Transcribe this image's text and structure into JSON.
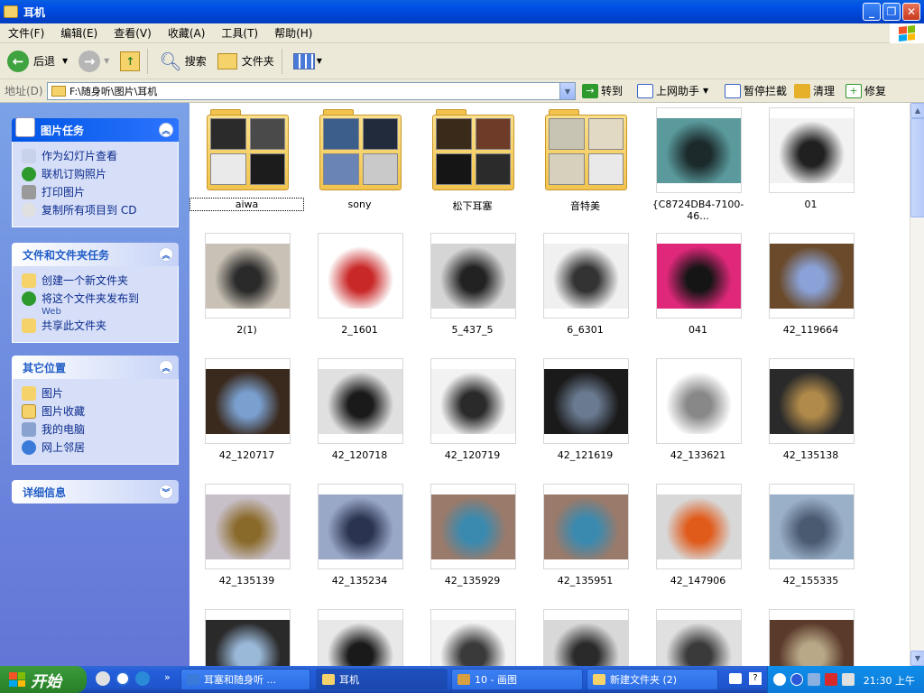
{
  "window": {
    "title": "耳机"
  },
  "menu": [
    "文件(F)",
    "编辑(E)",
    "查看(V)",
    "收藏(A)",
    "工具(T)",
    "帮助(H)"
  ],
  "toolbar": {
    "back": "后退",
    "search": "搜索",
    "folders": "文件夹"
  },
  "address": {
    "label": "地址(D)",
    "path": "F:\\随身听\\图片\\耳机",
    "go": "转到"
  },
  "addons": [
    "上网助手",
    "暂停拦截",
    "清理",
    "修复"
  ],
  "sidebar": {
    "picture_tasks": {
      "title": "图片任务",
      "items": [
        "作为幻灯片查看",
        "联机订购照片",
        "打印图片",
        "复制所有项目到 CD"
      ]
    },
    "file_tasks": {
      "title": "文件和文件夹任务",
      "items": [
        "创建一个新文件夹",
        "将这个文件夹发布到",
        "共享此文件夹"
      ],
      "publish_sub": "Web"
    },
    "other_places": {
      "title": "其它位置",
      "items": [
        "图片",
        "图片收藏",
        "我的电脑",
        "网上邻居"
      ]
    },
    "details": {
      "title": "详细信息"
    }
  },
  "files": [
    {
      "name": "aiwa",
      "kind": "folder",
      "colors": [
        "#2b2b2b",
        "#4a4a4a",
        "#eaeaea",
        "#1c1c1c"
      ]
    },
    {
      "name": "sony",
      "kind": "folder",
      "colors": [
        "#3c5e8a",
        "#222b3b",
        "#6a84b6",
        "#c9c9c9"
      ]
    },
    {
      "name": "松下耳塞",
      "kind": "folder",
      "colors": [
        "#3a2a1a",
        "#6d3b28",
        "#151515",
        "#2b2b2b"
      ]
    },
    {
      "name": "音特美",
      "kind": "folder",
      "colors": [
        "#c8c4b4",
        "#e2d9c5",
        "#d6d0bc",
        "#e9e9e9"
      ]
    },
    {
      "name": "{C8724DB4-7100-46...",
      "kind": "image",
      "colors": [
        "#5a9a9c",
        "#1c2a2c"
      ]
    },
    {
      "name": "01",
      "kind": "image",
      "colors": [
        "#f2f2f2",
        "#202020"
      ]
    },
    {
      "name": "2(1)",
      "kind": "image",
      "colors": [
        "#c9c1b5",
        "#2a2a2a"
      ]
    },
    {
      "name": "2_1601",
      "kind": "image",
      "colors": [
        "#ffffff",
        "#c92828"
      ]
    },
    {
      "name": "5_437_5",
      "kind": "image",
      "colors": [
        "#d5d5d5",
        "#222"
      ]
    },
    {
      "name": "6_6301",
      "kind": "image",
      "colors": [
        "#f0f0f0",
        "#333"
      ]
    },
    {
      "name": "041",
      "kind": "image",
      "colors": [
        "#e0287a",
        "#151515"
      ]
    },
    {
      "name": "42_119664",
      "kind": "image",
      "colors": [
        "#6a4a2a",
        "#8aa2d8"
      ]
    },
    {
      "name": "42_120717",
      "kind": "image",
      "colors": [
        "#3a2a1e",
        "#7aa0d0"
      ]
    },
    {
      "name": "42_120718",
      "kind": "image",
      "colors": [
        "#e0e0e0",
        "#1a1a1a"
      ]
    },
    {
      "name": "42_120719",
      "kind": "image",
      "colors": [
        "#f2f2f2",
        "#2a2a2a"
      ]
    },
    {
      "name": "42_121619",
      "kind": "image",
      "colors": [
        "#1a1a1a",
        "#6a7a90"
      ]
    },
    {
      "name": "42_133621",
      "kind": "image",
      "colors": [
        "#ffffff",
        "#888"
      ]
    },
    {
      "name": "42_135138",
      "kind": "image",
      "colors": [
        "#2a2a2a",
        "#b08a4a"
      ]
    },
    {
      "name": "42_135139",
      "kind": "image",
      "colors": [
        "#c8c0c8",
        "#8a6a2a"
      ]
    },
    {
      "name": "42_135234",
      "kind": "image",
      "colors": [
        "#9aa8c8",
        "#2a3450"
      ]
    },
    {
      "name": "42_135929",
      "kind": "image",
      "colors": [
        "#9a7a6a",
        "#3a8ab0"
      ]
    },
    {
      "name": "42_135951",
      "kind": "image",
      "colors": [
        "#9a7a6a",
        "#3a8ab0"
      ]
    },
    {
      "name": "42_147906",
      "kind": "image",
      "colors": [
        "#d8d8d8",
        "#e05a1a"
      ]
    },
    {
      "name": "42_155335",
      "kind": "image",
      "colors": [
        "#9ab0c8",
        "#4a5a70"
      ]
    },
    {
      "name": "",
      "kind": "image",
      "colors": [
        "#2a2a2a",
        "#9ab8d8"
      ]
    },
    {
      "name": "",
      "kind": "image",
      "colors": [
        "#e8e8e8",
        "#1a1a1a"
      ]
    },
    {
      "name": "",
      "kind": "image",
      "colors": [
        "#f2f2f2",
        "#3a3a3a"
      ]
    },
    {
      "name": "",
      "kind": "image",
      "colors": [
        "#d8d8d8",
        "#2a2a2a"
      ]
    },
    {
      "name": "",
      "kind": "image",
      "colors": [
        "#e0e0e0",
        "#3a3a3a"
      ]
    },
    {
      "name": "",
      "kind": "image",
      "colors": [
        "#5a3a2a",
        "#b8a888"
      ]
    }
  ],
  "taskbar": {
    "start": "开始",
    "tasks": [
      "耳塞和随身听 ...",
      "耳机",
      "10 - 画图",
      "新建文件夹 (2)"
    ],
    "clock": "21:30 上午"
  }
}
